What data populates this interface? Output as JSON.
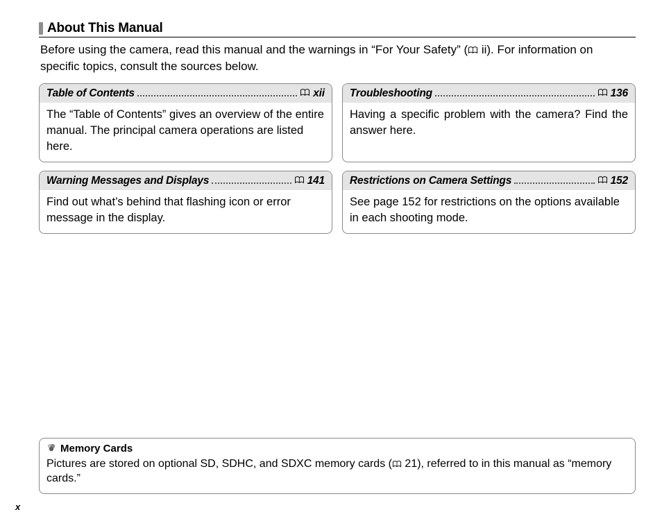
{
  "heading": "About This Manual",
  "intro_before_icon": "Before using the camera, read this manual and the warnings in “For Your Safety” (",
  "intro_after_icon": " ii).   For information on specific topics, consult the sources below.",
  "panels": [
    {
      "title": "Table of Contents",
      "page": "xii",
      "body": "The “Table of Contents” gives an overview of the entire manual.   The principal camera operations are listed here."
    },
    {
      "title": "Troubleshooting",
      "page": "136",
      "body": "Having a specific problem with the camera? Find the answer here.",
      "justify": true
    },
    {
      "title": "Warning Messages and Displays",
      "page": "141",
      "body": "Find out what’s behind that flashing icon or error message in the display."
    },
    {
      "title": "Restrictions on Camera Settings",
      "page": "152",
      "body": "See page 152 for restrictions on the options available in each shooting mode."
    }
  ],
  "note": {
    "title": "Memory Cards",
    "body_before_icon": "Pictures are stored on optional SD, SDHC, and SDXC memory cards (",
    "body_after_icon": " 21), referred to in this manual as “memory cards.”"
  },
  "page_number": "x"
}
